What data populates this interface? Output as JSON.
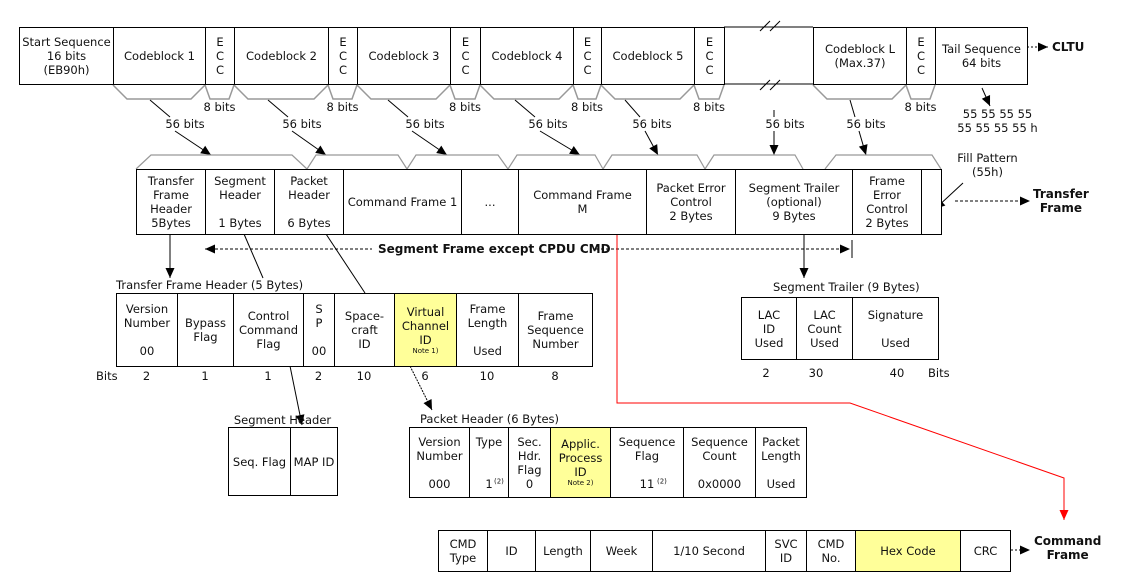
{
  "cltu": {
    "label": "CLTU",
    "cells": [
      "Start Sequence\n16 bits\n(EB90h)",
      "Codeblock 1",
      "E\nC\nC",
      "Codeblock 2",
      "E\nC\nC",
      "Codeblock 3",
      "E\nC\nC",
      "Codeblock 4",
      "E\nC\nC",
      "Codeblock 5",
      "E\nC\nC",
      "",
      "Codeblock L\n(Max.37)",
      "E\nC\nC",
      "Tail Sequence\n64 bits"
    ],
    "ecc_bits": "8 bits",
    "block_bits": "56 bits",
    "tail_value": "55 55 55 55\n55 55 55 55 h"
  },
  "transfer_frame": {
    "label": "Transfer\nFrame",
    "cells": [
      "Transfer\nFrame\nHeader\n5Bytes",
      "Segment\nHeader\n\n1 Bytes",
      "Packet\nHeader\n\n6 Bytes",
      "Command Frame 1",
      "...",
      "Command Frame\nM",
      "Packet Error\nControl\n2 Bytes",
      "Segment Trailer\n(optional)\n9 Bytes",
      "Frame\nError\nControl\n2 Bytes",
      ""
    ],
    "fill_pattern": "Fill Pattern\n(55h)",
    "segment_span": "Segment Frame except CPDU CMD"
  },
  "tf_header": {
    "title": "Transfer Frame Header (5 Bytes)",
    "cells": [
      "Version\nNumber\n\n00",
      "Bypass\nFlag",
      "Control\nCommand\nFlag",
      "S\nP\n\n00",
      "Space-\ncraft\nID",
      "Virtual\nChannel\nID",
      "Frame\nLength\n\nUsed",
      "Frame\nSequence\nNumber"
    ],
    "note": "Note 1)",
    "bits_label": "Bits",
    "bits": [
      "2",
      "1",
      "1",
      "2",
      "10",
      "6",
      "10",
      "8"
    ]
  },
  "segment_header": {
    "title": "Segment Header",
    "cells": [
      "Seq. Flag",
      "MAP ID"
    ]
  },
  "packet_header": {
    "title": "Packet Header (6 Bytes)",
    "cells": [
      "Version\nNumber\n\n000",
      "Type\n\n\n1",
      "Sec.\nHdr.\nFlag\n0",
      "Applic.\nProcess\nID",
      "Sequence\nFlag\n\n11",
      "Sequence\nCount\n\n0x0000",
      "Packet\nLength\n\nUsed"
    ],
    "sub": "(2)",
    "note": "Note 2)"
  },
  "segment_trailer": {
    "title": "Segment Trailer (9 Bytes)",
    "cells": [
      "LAC\nID\nUsed",
      "LAC\nCount\nUsed",
      "Signature\n\nUsed"
    ],
    "bits": [
      "2",
      "30",
      "40"
    ],
    "bits_label": "Bits"
  },
  "command_frame": {
    "label": "Command\nFrame",
    "cells": [
      "CMD\nType",
      "ID",
      "Length",
      "Week",
      "1/10 Second",
      "SVC\nID",
      "CMD\nNo.",
      "Hex Code",
      "CRC"
    ]
  },
  "colors": {
    "highlight": "#ffff99",
    "link_line": "#ff0000",
    "bracket": "#999999"
  }
}
